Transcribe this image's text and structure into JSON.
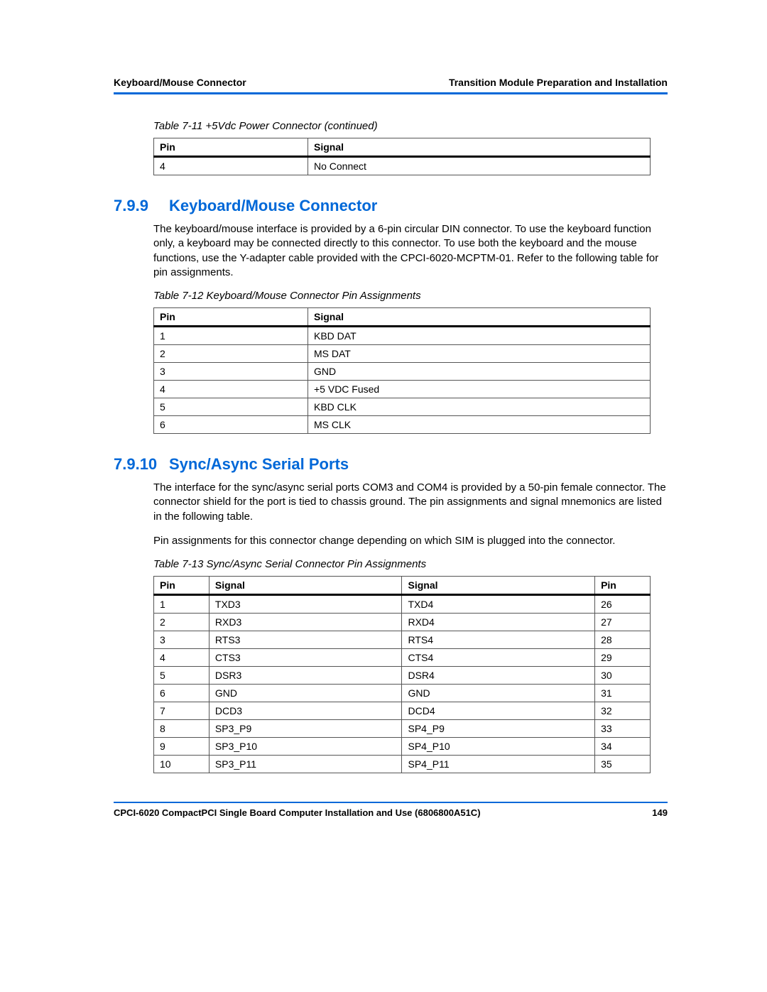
{
  "header": {
    "left": "Keyboard/Mouse Connector",
    "right": "Transition Module Preparation and Installation"
  },
  "table11": {
    "caption": "Table 7-11 +5Vdc Power Connector (continued)",
    "head": [
      "Pin",
      "Signal"
    ],
    "rows": [
      [
        "4",
        "No Connect"
      ]
    ]
  },
  "section799": {
    "number": "7.9.9",
    "title": "Keyboard/Mouse Connector",
    "para": "The keyboard/mouse interface is provided by a 6-pin circular DIN connector. To use the keyboard function only, a keyboard may be connected directly to this connector. To use both the keyboard and the mouse functions, use the Y-adapter cable provided with the CPCI-6020-MCPTM-01. Refer to the following table for pin assignments."
  },
  "table12": {
    "caption": "Table 7-12 Keyboard/Mouse Connector Pin Assignments",
    "head": [
      "Pin",
      "Signal"
    ],
    "rows": [
      [
        "1",
        "KBD DAT"
      ],
      [
        "2",
        "MS DAT"
      ],
      [
        "3",
        "GND"
      ],
      [
        "4",
        "+5 VDC Fused"
      ],
      [
        "5",
        "KBD CLK"
      ],
      [
        "6",
        "MS CLK"
      ]
    ]
  },
  "section7910": {
    "number": "7.9.10",
    "title": "Sync/Async Serial Ports",
    "para1": "The interface for the sync/async serial ports COM3 and COM4 is provided by a 50-pin female connector. The connector shield for the port is tied to chassis ground. The pin assignments and signal mnemonics are listed in the following table.",
    "para2": "Pin assignments for this connector change depending on which SIM is plugged into the connector."
  },
  "table13": {
    "caption": "Table 7-13 Sync/Async Serial Connector Pin Assignments",
    "head": [
      "Pin",
      "Signal",
      "Signal",
      "Pin"
    ],
    "rows": [
      [
        "1",
        "TXD3",
        "TXD4",
        "26"
      ],
      [
        "2",
        "RXD3",
        "RXD4",
        "27"
      ],
      [
        "3",
        "RTS3",
        "RTS4",
        "28"
      ],
      [
        "4",
        "CTS3",
        "CTS4",
        "29"
      ],
      [
        "5",
        "DSR3",
        "DSR4",
        "30"
      ],
      [
        "6",
        "GND",
        "GND",
        "31"
      ],
      [
        "7",
        "DCD3",
        "DCD4",
        "32"
      ],
      [
        "8",
        "SP3_P9",
        "SP4_P9",
        "33"
      ],
      [
        "9",
        "SP3_P10",
        "SP4_P10",
        "34"
      ],
      [
        "10",
        "SP3_P11",
        "SP4_P11",
        "35"
      ]
    ]
  },
  "footer": {
    "left": "CPCI-6020 CompactPCI Single Board Computer Installation and Use (6806800A51C)",
    "right": "149"
  }
}
